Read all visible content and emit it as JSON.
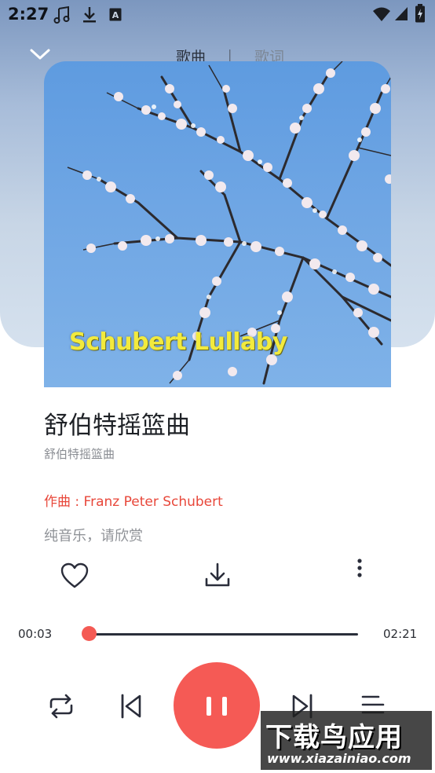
{
  "status_bar": {
    "time": "2:27",
    "icons": [
      "music-note-icon",
      "download-icon",
      "a-badge-icon",
      "wifi-icon",
      "cell-signal-icon",
      "battery-charging-icon"
    ]
  },
  "nav": {
    "back_icon": "chevron-down-icon",
    "tabs": [
      {
        "label": "歌曲",
        "active": true
      },
      {
        "label": "歌词",
        "active": false
      }
    ],
    "separator": "|"
  },
  "album_art": {
    "caption": "Schubert Lullaby"
  },
  "song": {
    "title": "舒伯特摇篮曲",
    "subtitle": "舒伯特摇篮曲",
    "composer_line": "作曲 : Franz Peter Schubert",
    "lyric_line": "纯音乐，请欣赏"
  },
  "actions": {
    "like_icon": "heart-outline-icon",
    "download_icon": "download-icon",
    "more_icon": "more-vertical-icon"
  },
  "progress": {
    "current": "00:03",
    "total": "02:21",
    "fraction": 0.02
  },
  "controls": {
    "repeat_icon": "repeat-icon",
    "prev_icon": "skip-previous-icon",
    "play_state": "pause-icon",
    "next_icon": "skip-next-icon",
    "playlist_icon": "playlist-icon"
  },
  "watermark": {
    "title": "下载鸟应用",
    "url": "www.xiazainiao.com"
  },
  "colors": {
    "accent": "#f55a55",
    "composer_text": "#e8473a",
    "caption_text": "#f2ea3d"
  }
}
